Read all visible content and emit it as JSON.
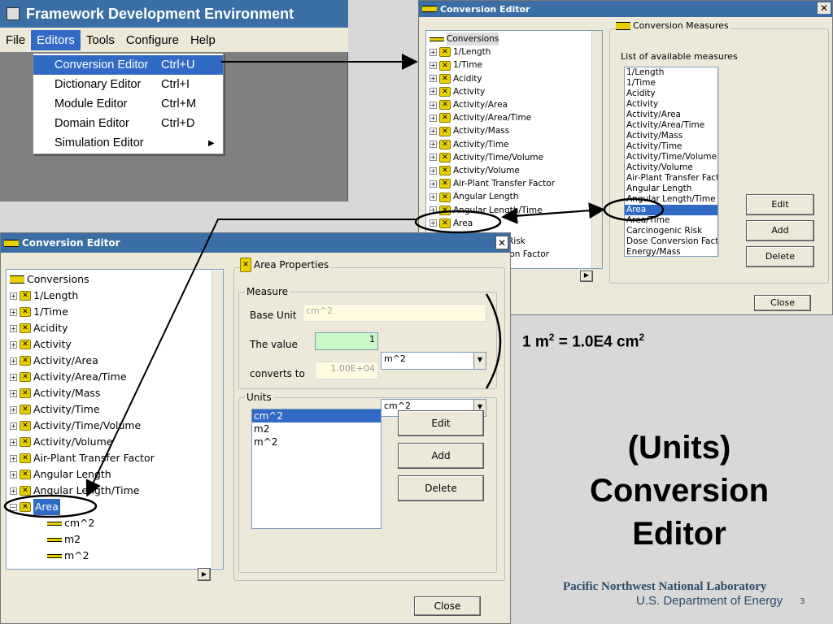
{
  "main_window": {
    "title": "Framework Development Environment",
    "menu": [
      "File",
      "Editors",
      "Tools",
      "Configure",
      "Help"
    ],
    "editors_menu": [
      {
        "label": "Conversion Editor",
        "shortcut": "Ctrl+U"
      },
      {
        "label": "Dictionary Editor",
        "shortcut": "Ctrl+I"
      },
      {
        "label": "Module Editor",
        "shortcut": "Ctrl+M"
      },
      {
        "label": "Domain Editor",
        "shortcut": "Ctrl+D"
      },
      {
        "label": "Simulation Editor",
        "shortcut": ""
      }
    ]
  },
  "small_editor": {
    "title": "Conversion Editor",
    "close_glyph": "✕",
    "tree_root": "Conversions",
    "tree_items": [
      "1/Length",
      "1/Time",
      "Acidity",
      "Activity",
      "Activity/Area",
      "Activity/Area/Time",
      "Activity/Mass",
      "Activity/Time",
      "Activity/Time/Volume",
      "Activity/Volume",
      "Air-Plant Transfer Factor",
      "Angular Length",
      "Angular Length/Time",
      "Area"
    ],
    "behind_text": [
      "Risk",
      "sion Factor"
    ],
    "group_label": "Conversion Measures",
    "list_label": "List of available measures",
    "measures": [
      "1/Length",
      "1/Time",
      "Acidity",
      "Activity",
      "Activity/Area",
      "Activity/Area/Time",
      "Activity/Mass",
      "Activity/Time",
      "Activity/Time/Volume",
      "Activity/Volume",
      "Air-Plant Transfer Facto",
      "Angular Length",
      "Angular Length/Time",
      "Area",
      "Area/Time",
      "Carcinogenic Risk",
      "Dose Conversion Facto",
      "Energy/Mass"
    ],
    "buttons": {
      "edit": "Edit",
      "add": "Add",
      "delete": "Delete",
      "close": "Close"
    }
  },
  "large_editor": {
    "title": "Conversion Editor",
    "close_glyph": "✕",
    "tree_root": "Conversions",
    "tree_items": [
      "1/Length",
      "1/Time",
      "Acidity",
      "Activity",
      "Activity/Area",
      "Activity/Area/Time",
      "Activity/Mass",
      "Activity/Time",
      "Activity/Time/Volume",
      "Activity/Volume",
      "Air-Plant Transfer Factor",
      "Angular Length",
      "Angular Length/Time"
    ],
    "selected_item": "Area",
    "sub_items": [
      "cm^2",
      "m2",
      "m^2"
    ],
    "props_title": "Area Properties",
    "measure_label": "Measure",
    "base_unit_label": "Base Unit",
    "base_unit_value": "cm^2",
    "value_label": "The value",
    "value_input": "1",
    "value_unit": "m^2",
    "converts_label": "converts to",
    "converts_value": "1.00E+04",
    "converts_unit": "cm^2",
    "units_label": "Units",
    "units": [
      "cm^2",
      "m2",
      "m^2"
    ],
    "buttons": {
      "edit": "Edit",
      "add": "Add",
      "delete": "Delete",
      "close": "Close"
    }
  },
  "equation": {
    "lhs": "1 m",
    "sup1": "2",
    "mid": " = 1.0E4 cm",
    "sup2": "2"
  },
  "slide_title": [
    "(Units)",
    "Conversion",
    "Editor"
  ],
  "footer": {
    "lab": "Pacific Northwest National Laboratory",
    "dept": "U.S. Department of Energy",
    "page": "3"
  }
}
